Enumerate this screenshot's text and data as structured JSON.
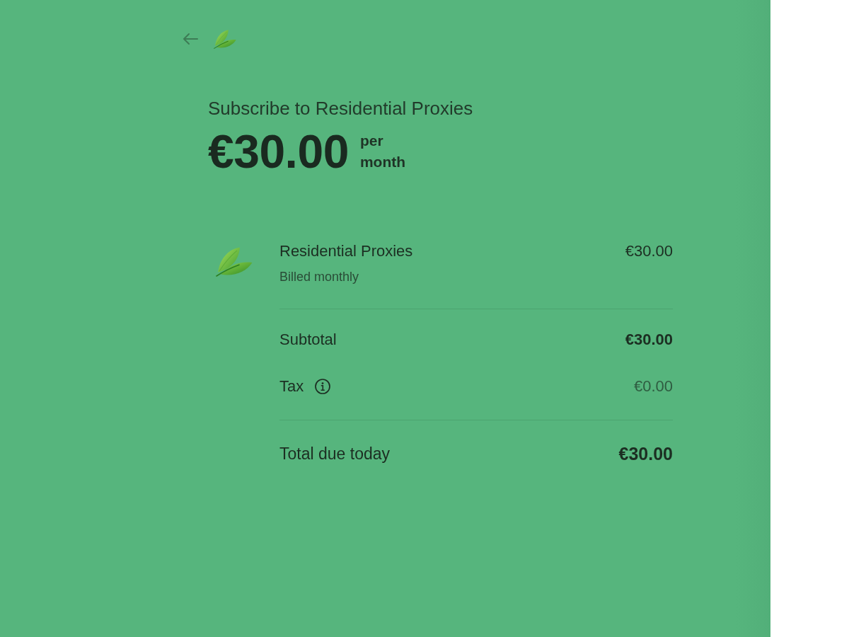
{
  "summary": {
    "title": "Subscribe to Residential Proxies",
    "price": "€30.00",
    "interval": "per month"
  },
  "line_items": [
    {
      "name": "Residential Proxies",
      "detail": "Billed monthly",
      "amount": "€30.00"
    }
  ],
  "totals": [
    {
      "kind": "subtotal",
      "label": "Subtotal",
      "amount": "€30.00"
    },
    {
      "kind": "tax",
      "label": "Tax",
      "amount": "€0.00"
    },
    {
      "kind": "total",
      "label": "Total due today",
      "amount": "€30.00"
    }
  ]
}
